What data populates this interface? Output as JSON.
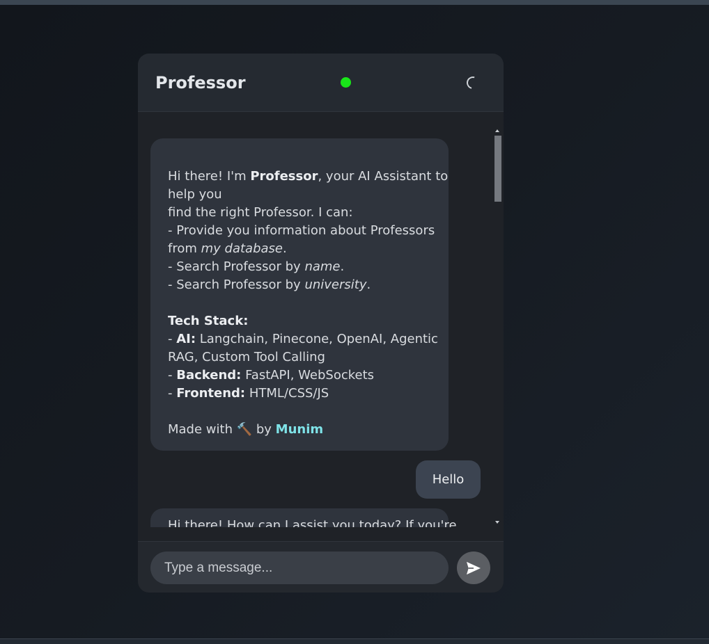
{
  "header": {
    "title": "Professor"
  },
  "messages": {
    "intro": {
      "greeting_pre": "Hi there! I'm ",
      "greeting_bold": "Professor",
      "greeting_post": ", your AI Assistant to",
      "line2": "help you",
      "line3": "find the right Professor. I can:",
      "line4": "- Provide you information about Professors",
      "line5_pre": "from ",
      "line5_italic": "my database",
      "line5_post": ".",
      "line6_pre": "- Search Professor by ",
      "line6_italic": "name",
      "line6_post": ".",
      "line7_pre": "- Search Professor by ",
      "line7_italic": "university",
      "line7_post": ".",
      "tech_heading": "Tech Stack:",
      "ai_prefix": "- ",
      "ai_label": "AI:",
      "ai_value": " Langchain, Pinecone, OpenAI, Agentic",
      "ai_value2": "RAG, Custom Tool Calling",
      "backend_prefix": "- ",
      "backend_label": "Backend:",
      "backend_value": " FastAPI, WebSockets",
      "frontend_prefix": "- ",
      "frontend_label": "Frontend:",
      "frontend_value": " HTML/CSS/JS",
      "made_with_pre": "Made with ",
      "made_with_icon": "🔨",
      "made_with_by": " by ",
      "author": "Munim"
    },
    "user_message": "Hello",
    "reply_partial": "Hi there! How can I assist you today? If you're"
  },
  "composer": {
    "placeholder": "Type a message..."
  },
  "colors": {
    "status": "#19e619",
    "author_link": "#7fe3e8"
  },
  "icons": {
    "status": "online-status-dot",
    "loading": "loading-spinner-icon",
    "send": "send-icon"
  }
}
